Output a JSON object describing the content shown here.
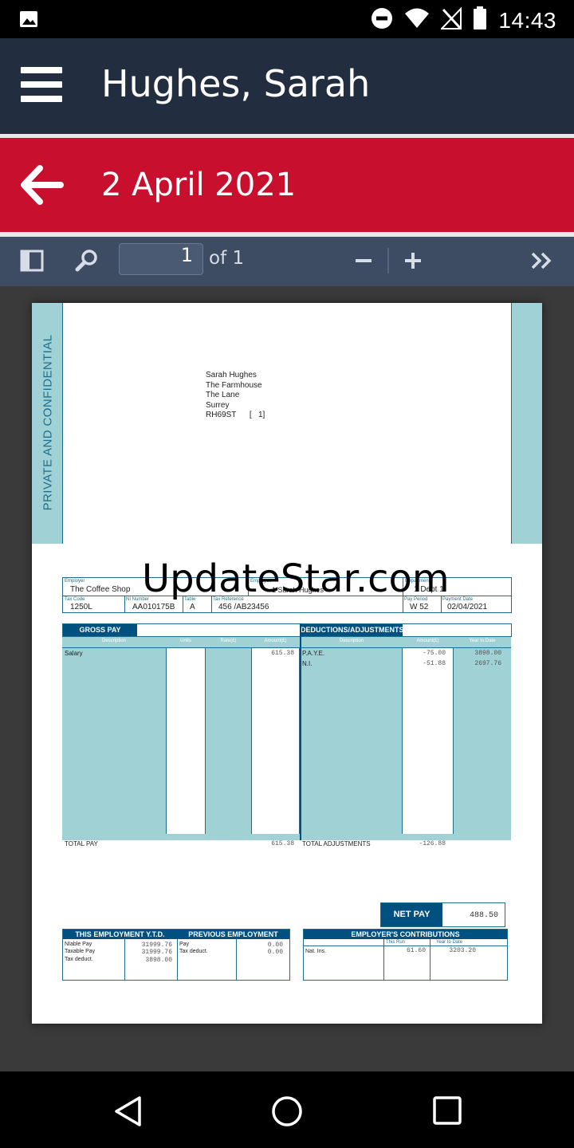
{
  "status_bar": {
    "time": "14:43",
    "icons": [
      "image-notification-icon",
      "do-not-disturb-icon",
      "wifi-icon",
      "no-signal-icon",
      "battery-icon"
    ]
  },
  "header": {
    "title": "Hughes, Sarah",
    "background": "#222e3f"
  },
  "date_bar": {
    "date": "2 April 2021",
    "background": "#c8102e"
  },
  "pdf_toolbar": {
    "page_value": "1",
    "page_of": "of 1"
  },
  "payslip": {
    "confidential_label": "PRIVATE AND CONFIDENTIAL",
    "address": [
      "Sarah Hughes",
      "The Farmhouse",
      "The Lane",
      "Surrey",
      "RH69ST      [   1]"
    ],
    "watermark": "UpdateStar.com",
    "labels": {
      "employer": "Employer",
      "employee": "Employee",
      "department": "Department",
      "tax_code": "Tax Code",
      "ni_number": "NI Number",
      "table": "Table",
      "tax_reference": "Tax Reference",
      "pay_period": "Pay Period",
      "payment_date": "Payment Date"
    },
    "employer": "The Coffee Shop",
    "employee": "1  Sarah Hughes",
    "department": "1  Dept 1",
    "tax_code": "1250L",
    "ni_number": "AA010175B",
    "table": "A",
    "tax_reference": "456  /AB23456",
    "pay_period": "W 52",
    "payment_date": "02/04/2021",
    "gross_pay": {
      "heading": "GROSS PAY",
      "columns": [
        "Description",
        "Units",
        "Rate(£)",
        "Amount(£)"
      ],
      "rows": [
        {
          "description": "Salary",
          "units": "",
          "rate": "",
          "amount": "615.38"
        }
      ],
      "total_label": "TOTAL PAY",
      "total": "615.38"
    },
    "deductions": {
      "heading": "DEDUCTIONS/ADJUSTMENTS",
      "columns": [
        "Description",
        "Amount(£)",
        "Year to Date"
      ],
      "rows": [
        {
          "description": "P.A.Y.E.",
          "amount": "-75.00",
          "ytd": "3898.00"
        },
        {
          "description": "N.I.",
          "amount": "-51.88",
          "ytd": "2697.76"
        }
      ],
      "total_label": "TOTAL ADJUSTMENTS",
      "total": "-126.88"
    },
    "net_pay": {
      "label": "NET PAY",
      "value": "488.50"
    },
    "this_employment": {
      "heading": "THIS EMPLOYMENT Y.T.D.",
      "rows": [
        {
          "label": "NIable Pay",
          "value": "31999.76"
        },
        {
          "label": "Taxable Pay",
          "value": "31999.76"
        },
        {
          "label": "Tax deduct.",
          "value": "3898.00"
        }
      ]
    },
    "previous_employment": {
      "heading": "PREVIOUS EMPLOYMENT",
      "rows": [
        {
          "label": "Pay",
          "value": "0.00"
        },
        {
          "label": "Tax deduct.",
          "value": "0.00"
        }
      ]
    },
    "employer_contributions": {
      "heading": "EMPLOYER'S CONTRIBUTIONS",
      "columns": [
        "This Run",
        "Year to Date"
      ],
      "rows": [
        {
          "label": "Nat. Ins.",
          "this_run": "61.60",
          "ytd": "3203.20"
        }
      ]
    },
    "colors": {
      "teal": "#a0d1d5",
      "navy": "#005080",
      "line": "#1e6f8e"
    }
  },
  "nav_bar": {
    "buttons": [
      "back-nav-icon",
      "home-nav-icon",
      "recents-nav-icon"
    ]
  }
}
